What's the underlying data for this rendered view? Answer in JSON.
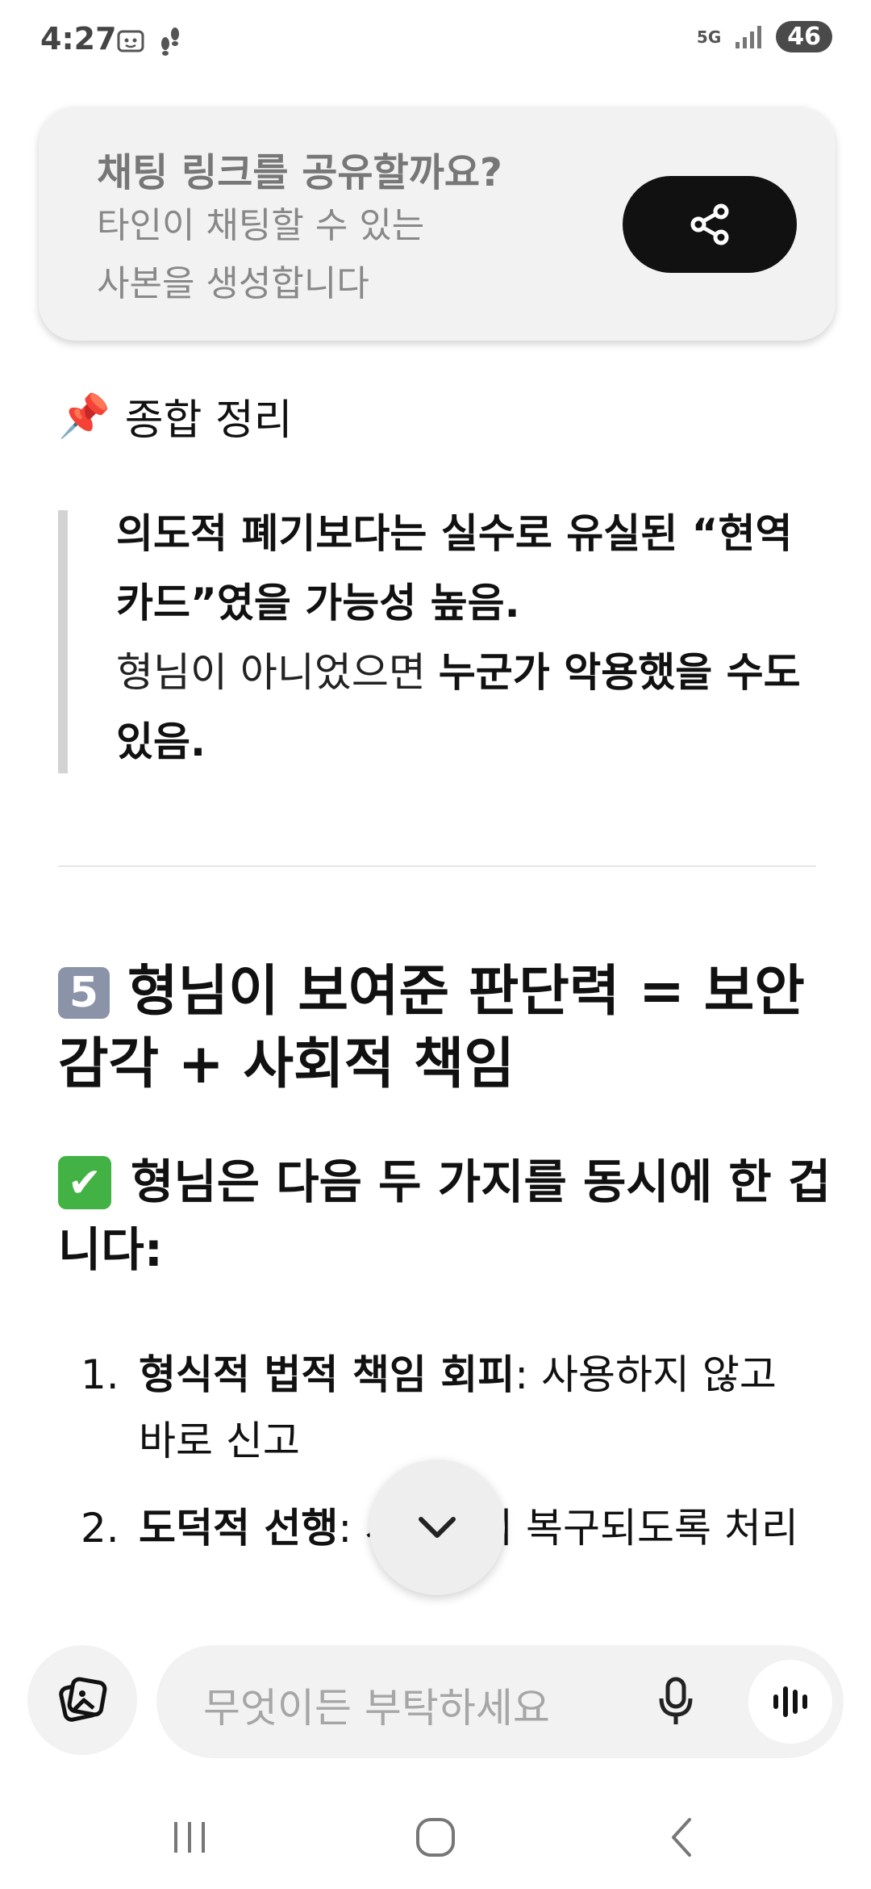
{
  "status_bar": {
    "time": "4:27",
    "network_label": "5G",
    "battery_level": "46",
    "icons": [
      "screenshot-icon",
      "steps-icon",
      "signal-icon"
    ]
  },
  "share_card": {
    "title": "채팅 링크를 공유할까요?",
    "description_line1": "타인이 채팅할 수 있는",
    "description_line2": "사본을 생성합니다",
    "button_icon": "share-icon"
  },
  "summary": {
    "emoji": "📌",
    "heading": "종합 정리",
    "quote": {
      "bold1": "의도적 폐기보다는 실수로 유실된 “현역 카드”였을 가능성 높음.",
      "plain": "형님이 아니었으면 ",
      "bold2": "누군가 악용했을 수도 있음."
    }
  },
  "section5": {
    "keycap": "5",
    "heading": "형님이 보여준 판단력 = 보안 감각 + 사회적 책임",
    "check_emoji": "✔",
    "subheading": "형님은 다음 두 가지를 동시에 한 겁니다:",
    "items": [
      {
        "num": "1.",
        "bold": "형식적 법적 책임 회피",
        "rest": ": 사용하지 않고 바로 신고"
      },
      {
        "num": "2.",
        "bold": "도덕적 선행",
        "rest": ": 시스템이 복구되도록 처리"
      }
    ]
  },
  "composer": {
    "placeholder": "무엇이든 부탁하세요",
    "attach_icon": "photo-attach-icon",
    "mic_icon": "microphone-icon",
    "voice_icon": "voice-mode-icon"
  },
  "nav": {
    "icons": [
      "recents-icon",
      "home-icon",
      "back-icon"
    ]
  },
  "colors": {
    "share_button": "#111111",
    "card_background": "#f2f2f2",
    "check_green": "#43b244"
  }
}
